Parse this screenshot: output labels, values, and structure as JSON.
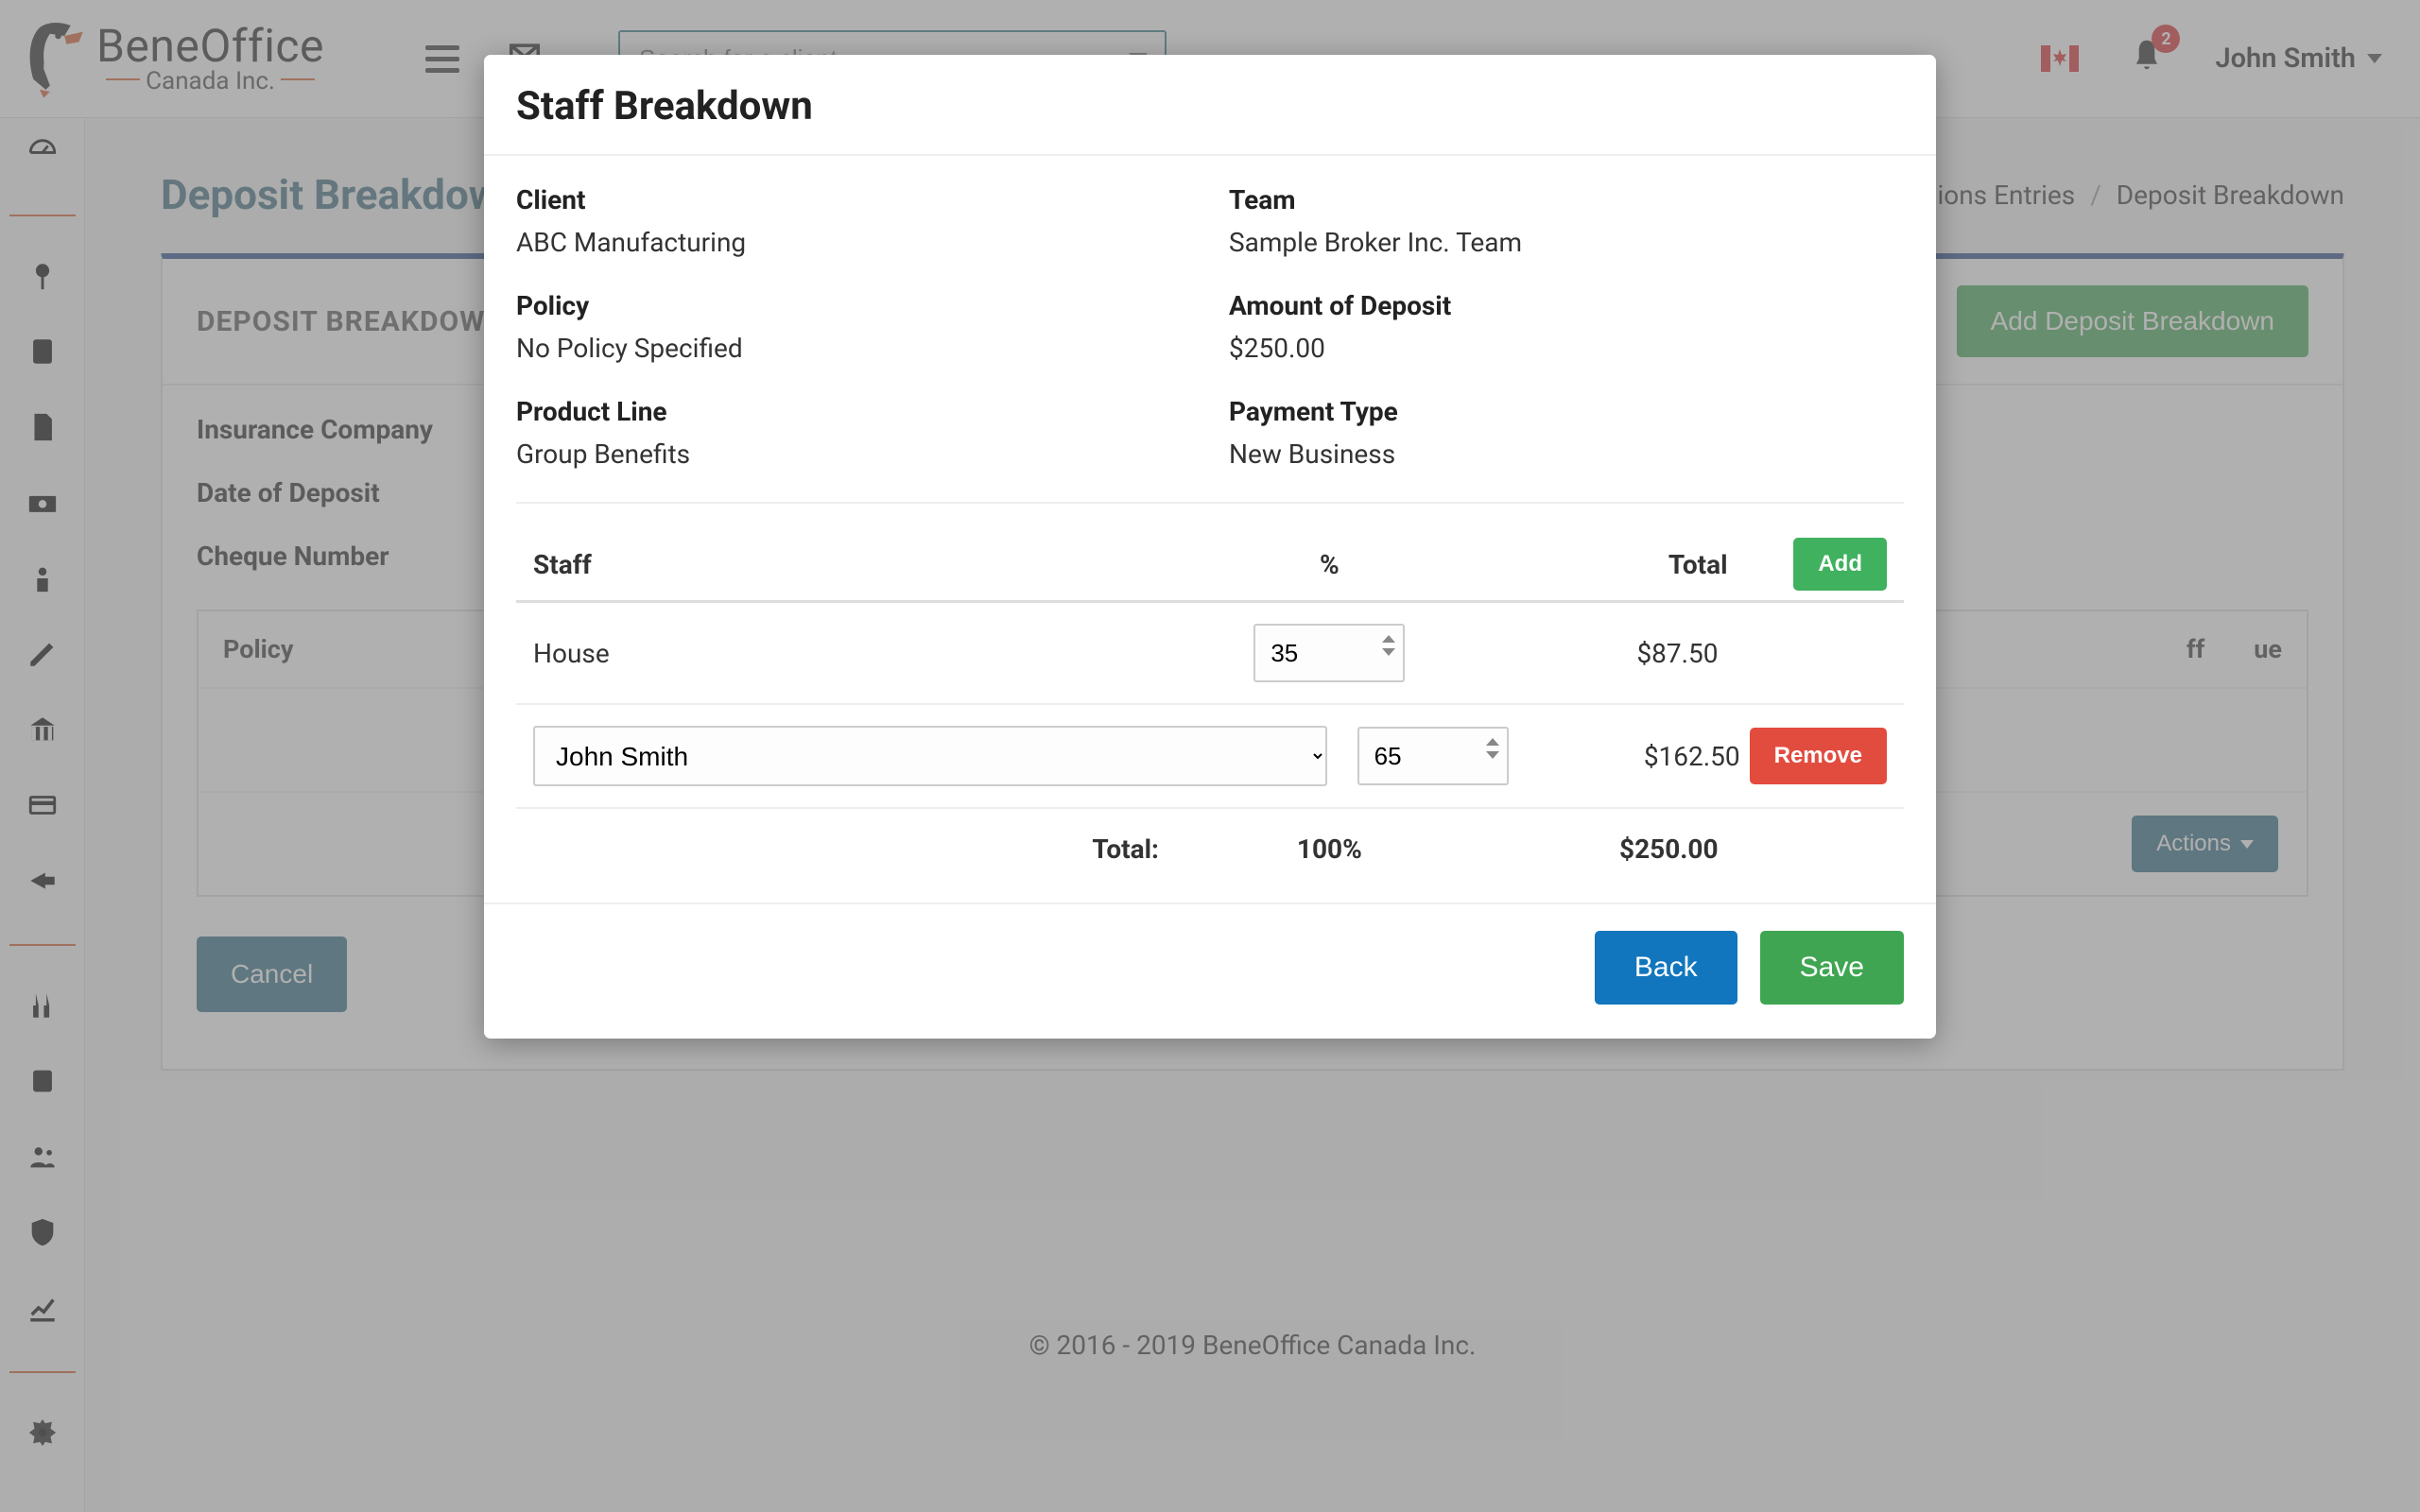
{
  "brand": {
    "main": "BeneOffice",
    "sub": "Canada Inc."
  },
  "header": {
    "search_placeholder": "Search for a client",
    "notification_count": "2",
    "user_name": "John Smith"
  },
  "page": {
    "title": "Deposit Breakdown",
    "breadcrumbs": [
      "ions Entries",
      "Deposit Breakdown"
    ],
    "card_title": "DEPOSIT BREAKDOWN",
    "add_button": "Add Deposit Breakdown",
    "meta_labels": {
      "insurance_company": "Insurance Company",
      "date_of_deposit": "Date of Deposit",
      "cheque_number": "Cheque Number"
    },
    "inner_headers": {
      "policy": "Policy",
      "staff_end": "ff",
      "queue_end": "ue"
    },
    "actions_label": "Actions",
    "cancel_label": "Cancel"
  },
  "footer": "© 2016 - 2019 BeneOffice Canada Inc.",
  "modal": {
    "title": "Staff Breakdown",
    "info": {
      "client_label": "Client",
      "client_value": "ABC Manufacturing",
      "team_label": "Team",
      "team_value": "Sample Broker Inc. Team",
      "policy_label": "Policy",
      "policy_value": "No Policy Specified",
      "amount_label": "Amount of Deposit",
      "amount_value": "$250.00",
      "product_label": "Product Line",
      "product_value": "Group Benefits",
      "payment_label": "Payment Type",
      "payment_value": "New Business"
    },
    "table": {
      "staff_header": "Staff",
      "pct_header": "%",
      "total_header": "Total",
      "add_label": "Add",
      "rows": [
        {
          "name": "House",
          "pct": "35",
          "total": "$87.50"
        },
        {
          "name": "John Smith",
          "pct": "65",
          "total": "$162.50"
        }
      ],
      "remove_label": "Remove",
      "footer": {
        "label": "Total:",
        "pct": "100%",
        "amount": "$250.00"
      }
    },
    "buttons": {
      "back": "Back",
      "save": "Save"
    }
  }
}
